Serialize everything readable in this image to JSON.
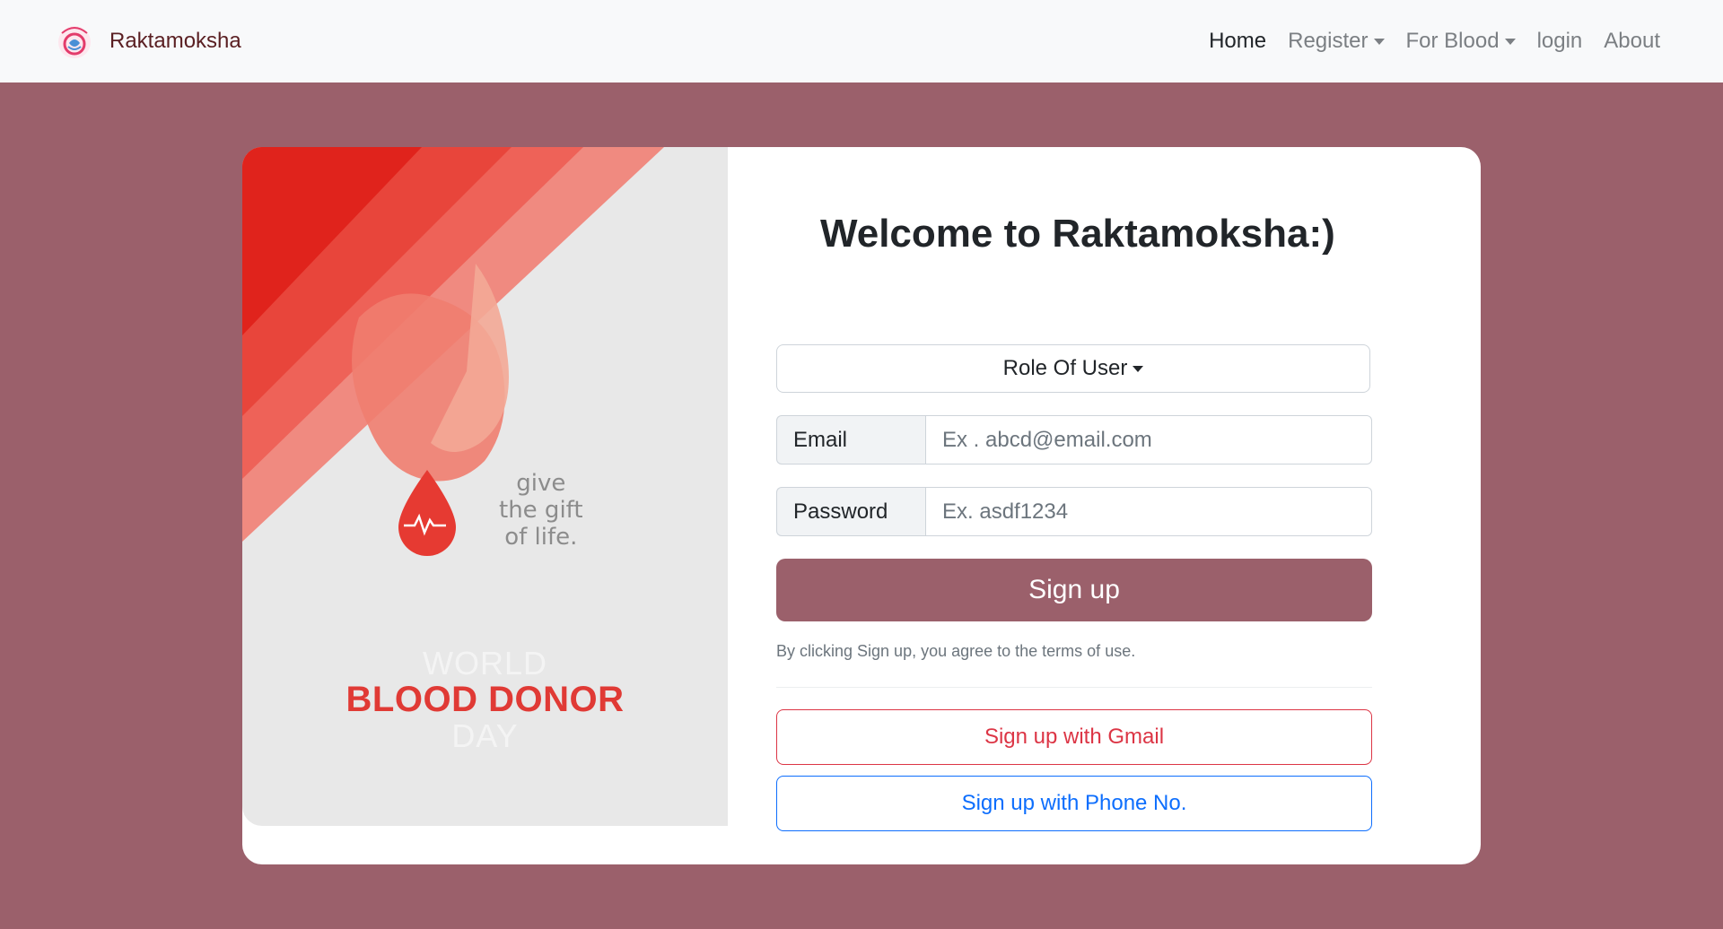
{
  "navbar": {
    "brand_name": "Raktamoksha",
    "logo_icon": "hand-in-hand-logo",
    "items": [
      {
        "label": "Home",
        "active": true,
        "dropdown": false
      },
      {
        "label": "Register",
        "active": false,
        "dropdown": true
      },
      {
        "label": "For Blood",
        "active": false,
        "dropdown": true
      },
      {
        "label": "login",
        "active": false,
        "dropdown": false
      },
      {
        "label": "About",
        "active": false,
        "dropdown": false
      }
    ]
  },
  "poster": {
    "give_line1": "give",
    "give_line2": "the gift",
    "give_line3": "of life.",
    "world": "WORLD",
    "blood_donor": "BLOOD DONOR",
    "day": "DAY"
  },
  "form": {
    "welcome": "Welcome to Raktamoksha:)",
    "role_label": "Role Of User",
    "email_label": "Email",
    "email_placeholder": "Ex . abcd@email.com",
    "password_label": "Password",
    "password_placeholder": "Ex. asdf1234",
    "signup_label": "Sign up",
    "terms": "By clicking Sign up, you agree to the terms of use.",
    "gmail_label": "Sign up with Gmail",
    "phone_label": "Sign up with Phone No."
  },
  "colors": {
    "page_bg": "#9b606b",
    "primary": "#9b606b",
    "danger": "#dc3545",
    "info": "#0d6efd"
  }
}
